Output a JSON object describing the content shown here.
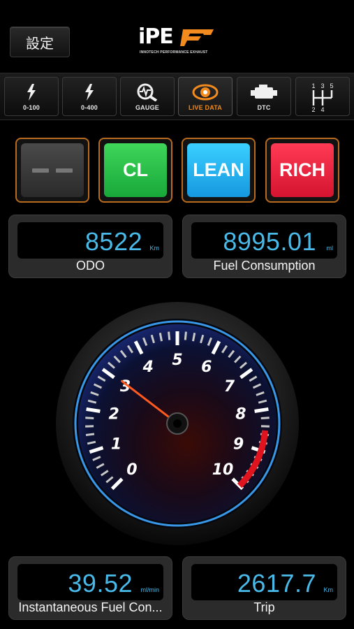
{
  "header": {
    "settings_label": "設定",
    "logo_text": "iPE",
    "logo_subtitle": "INNOTECH PERFORMANCE EXHAUST"
  },
  "tabs": [
    {
      "label": "0-100",
      "icon": "lightning-icon",
      "active": false
    },
    {
      "label": "0-400",
      "icon": "lightning-icon",
      "active": false
    },
    {
      "label": "GAUGE",
      "icon": "gauge-magnifier-icon",
      "active": false
    },
    {
      "label": "LIVE DATA",
      "icon": "eye-icon",
      "active": true
    },
    {
      "label": "DTC",
      "icon": "engine-icon",
      "active": false
    },
    {
      "label": "",
      "icon": "gear-shift-icon",
      "active": false,
      "shift_digits": [
        "1",
        "3",
        "5",
        "2",
        "4"
      ]
    }
  ],
  "status_lamps": [
    {
      "name": "off",
      "label": "",
      "color": "#3a3a3a"
    },
    {
      "name": "cl",
      "label": "CL",
      "color": "#22b544"
    },
    {
      "name": "lean",
      "label": "LEAN",
      "color": "#23a9ef"
    },
    {
      "name": "rich",
      "label": "RICH",
      "color": "#e51d3a"
    }
  ],
  "readouts": {
    "odo": {
      "value": "8522",
      "unit": "Km",
      "label": "ODO"
    },
    "fuel_consumption": {
      "value": "8995.01",
      "unit": "ml",
      "label": "Fuel Consumption"
    },
    "instant_fuel": {
      "value": "39.52",
      "unit": "ml/min",
      "label": "Instantaneous Fuel Con..."
    },
    "trip": {
      "value": "2617.7",
      "unit": "Km",
      "label": "Trip"
    }
  },
  "gauge": {
    "scale_labels": [
      "0",
      "1",
      "2",
      "3",
      "4",
      "5",
      "6",
      "7",
      "8",
      "9",
      "10"
    ],
    "min": 0,
    "max": 10,
    "needle_value": 3.05,
    "redline_from": 8.5,
    "colors": {
      "accent": "#3ea8ff",
      "needle": "#ff5a1f",
      "redline": "#e0141e",
      "label_orange": "#f28a1e"
    }
  }
}
